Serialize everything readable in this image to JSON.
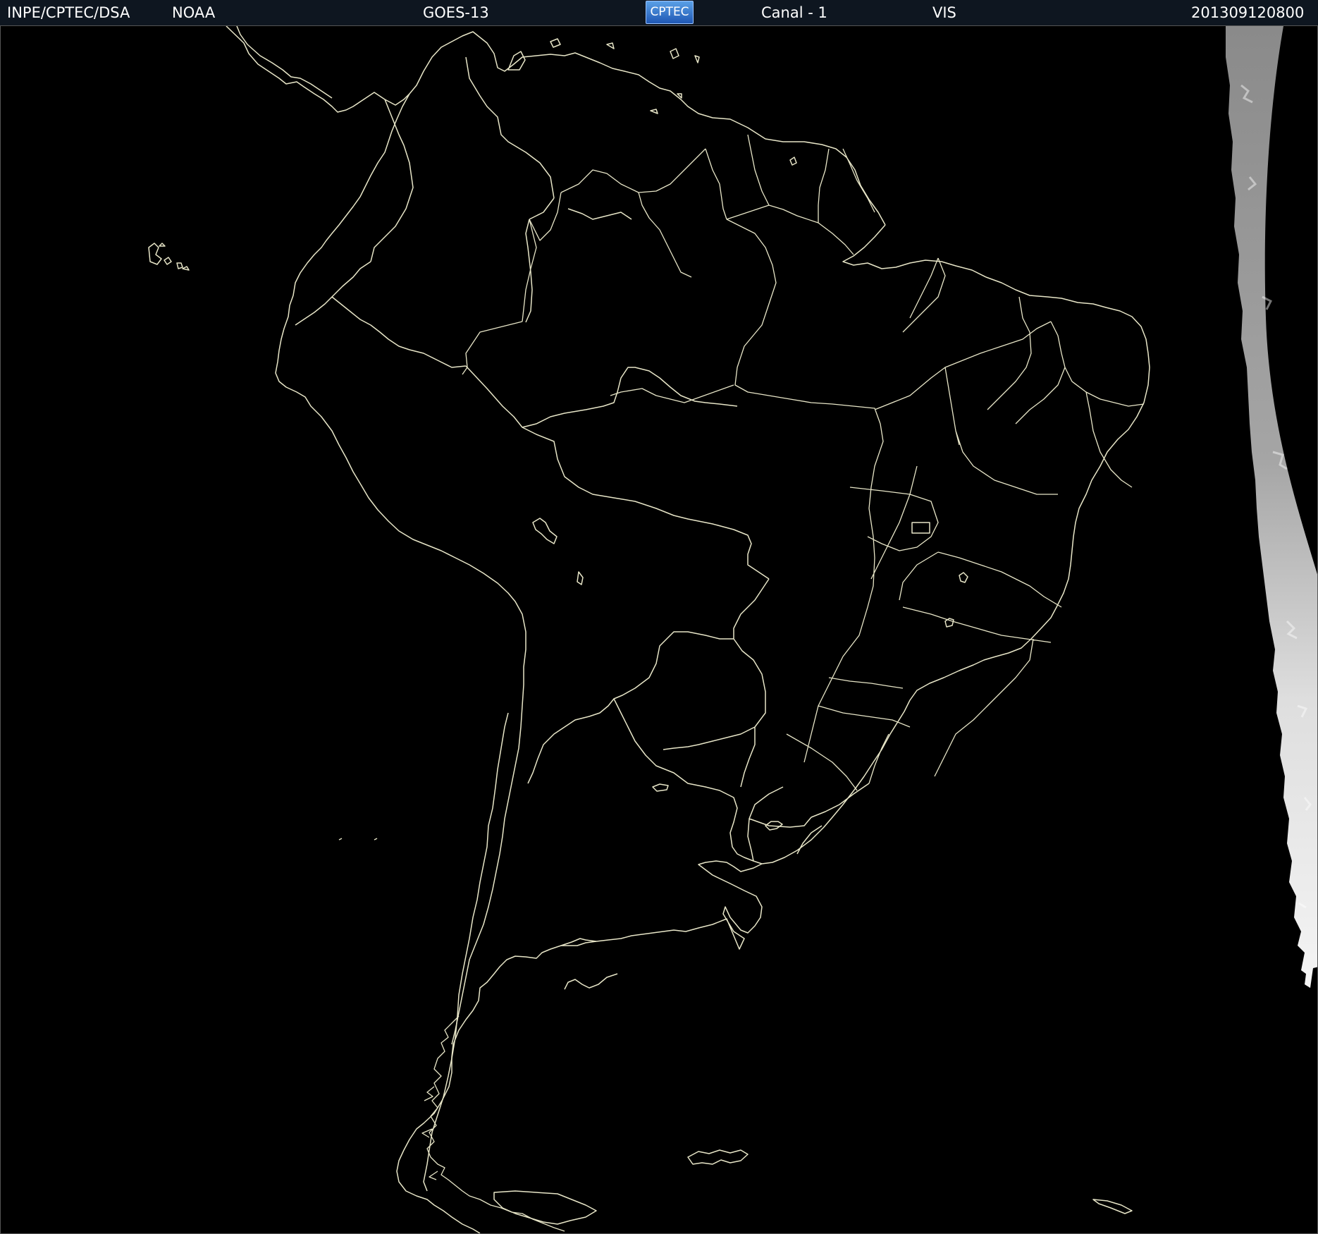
{
  "header": {
    "institution": "INPE/CPTEC/DSA",
    "agency": "NOAA",
    "satellite": "GOES-13",
    "logo_text": "CPTEC",
    "channel": "Canal - 1",
    "band": "VIS",
    "timestamp": "201309120800"
  },
  "map": {
    "outline_color": "#e8e6c8",
    "background_color": "#000000",
    "cloud_color": "#d9d9d9"
  }
}
